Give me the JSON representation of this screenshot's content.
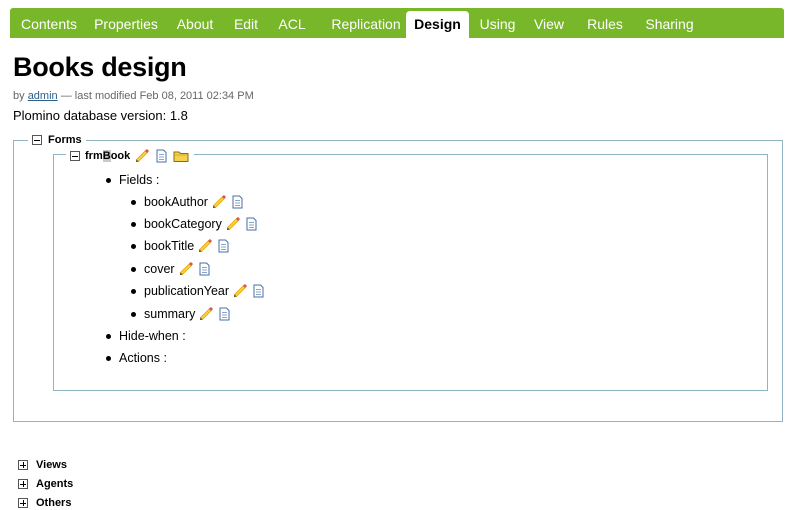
{
  "tabs": [
    {
      "label": "Contents",
      "active": false
    },
    {
      "label": "Properties",
      "active": false
    },
    {
      "label": "About",
      "active": false
    },
    {
      "label": "Edit",
      "active": false
    },
    {
      "label": "ACL",
      "active": false
    },
    {
      "label": "Replication",
      "active": false
    },
    {
      "label": "Design",
      "active": true
    },
    {
      "label": "Using",
      "active": false
    },
    {
      "label": "View",
      "active": false
    },
    {
      "label": "Rules",
      "active": false
    },
    {
      "label": "Sharing",
      "active": false
    }
  ],
  "page": {
    "title": "Books design",
    "byline_prefix": "by",
    "author": "admin",
    "byline_suffix": "— last modified Feb 08, 2011 02:34 PM",
    "version": "Plomino database version: 1.8"
  },
  "forms": {
    "label": "Forms",
    "form_name_a": "frm",
    "form_name_sel": "B",
    "form_name_b": "ook",
    "fields_label": "Fields :",
    "fields": [
      "bookAuthor",
      "bookCategory",
      "bookTitle",
      "cover",
      "publicationYear",
      "summary"
    ],
    "hidewhen_label": "Hide-when :",
    "actions_label": "Actions :"
  },
  "sections": {
    "views": "Views",
    "agents": "Agents",
    "others": "Others"
  },
  "colors": {
    "tabbar": "#78b72a",
    "border": "#8fb5c4",
    "link": "#2c5f8a"
  },
  "icons": [
    "pencil-icon",
    "document-icon",
    "folder-icon",
    "collapse-icon",
    "expand-icon"
  ]
}
